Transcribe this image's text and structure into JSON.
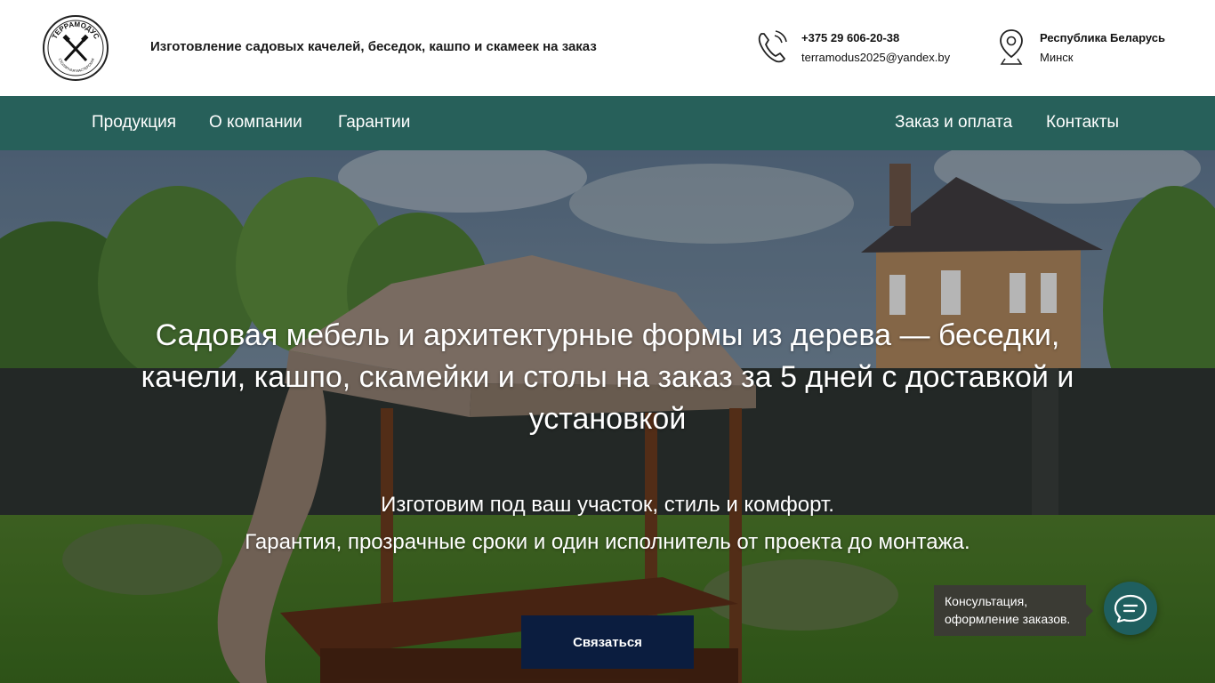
{
  "header": {
    "logo_text_top": "ТЕРРАМОДУС",
    "logo_text_bottom": "СТОЛЯРНАЯ МАСТЕРСКАЯ",
    "tagline": "Изготовление садовых качелей, беседок, кашпо и скамеек на заказ",
    "phone": "+375 29 606-20-38",
    "email": "terramodus2025@yandex.by",
    "country": "Республика Беларусь",
    "city": "Минск",
    "icons": {
      "phone": "phone-icon",
      "location": "location-pin-icon"
    }
  },
  "nav": {
    "items": [
      {
        "label": "Продукция"
      },
      {
        "label": "О компании"
      },
      {
        "label": "Гарантии"
      },
      {
        "label": "Заказ и оплата"
      },
      {
        "label": "Контакты"
      }
    ],
    "background": "#27605a"
  },
  "hero": {
    "title": "Садовая мебель и архитектурные формы из дерева — беседки, качели, кашпо, скамейки и столы на  заказ за 5 дней с доставкой и установкой",
    "subtitle_line1": "Изготовим под ваш участок, стиль и комфорт.",
    "subtitle_line2": "Гарантия, прозрачные сроки и один исполнитель от проекта до монтажа.",
    "cta_label": "Связаться",
    "cta_color": "#0b1d3f"
  },
  "chat": {
    "tooltip": "Консультация, оформление заказов.",
    "icon": "chat-bubble-icon",
    "color": "#1f5f5f"
  }
}
